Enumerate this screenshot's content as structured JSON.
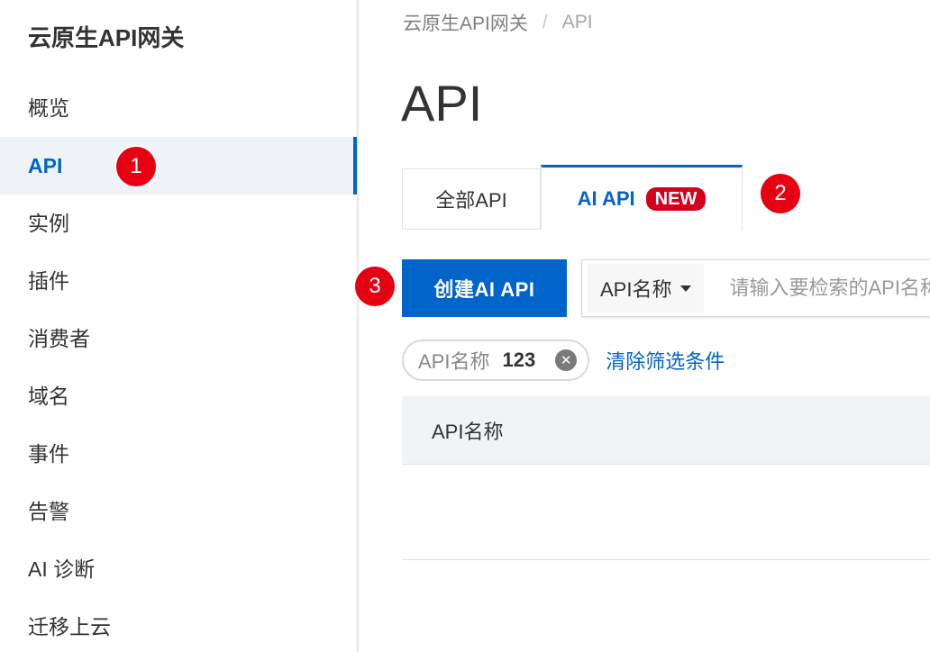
{
  "sidebar": {
    "title": "云原生API网关",
    "items": [
      {
        "label": "概览"
      },
      {
        "label": "API"
      },
      {
        "label": "实例"
      },
      {
        "label": "插件"
      },
      {
        "label": "消费者"
      },
      {
        "label": "域名"
      },
      {
        "label": "事件"
      },
      {
        "label": "告警"
      },
      {
        "label": "AI 诊断"
      },
      {
        "label": "迁移上云"
      }
    ],
    "active_index": 1
  },
  "breadcrumb": {
    "root": "云原生API网关",
    "separator": "/",
    "current": "API"
  },
  "page": {
    "title": "API"
  },
  "tabs": {
    "all_label": "全部API",
    "ai_label": "AI API",
    "new_badge": "NEW"
  },
  "toolbar": {
    "create_label": "创建AI API",
    "search_field_label": "API名称",
    "search_placeholder": "请输入要检索的API名称"
  },
  "filter": {
    "key": "API名称",
    "value": "123",
    "clear_label": "清除筛选条件"
  },
  "table": {
    "columns": [
      "API名称"
    ]
  },
  "markers": [
    "1",
    "2",
    "3"
  ],
  "colors": {
    "accent": "#0064c8",
    "marker": "#e60012",
    "badge": "#d6001c"
  }
}
